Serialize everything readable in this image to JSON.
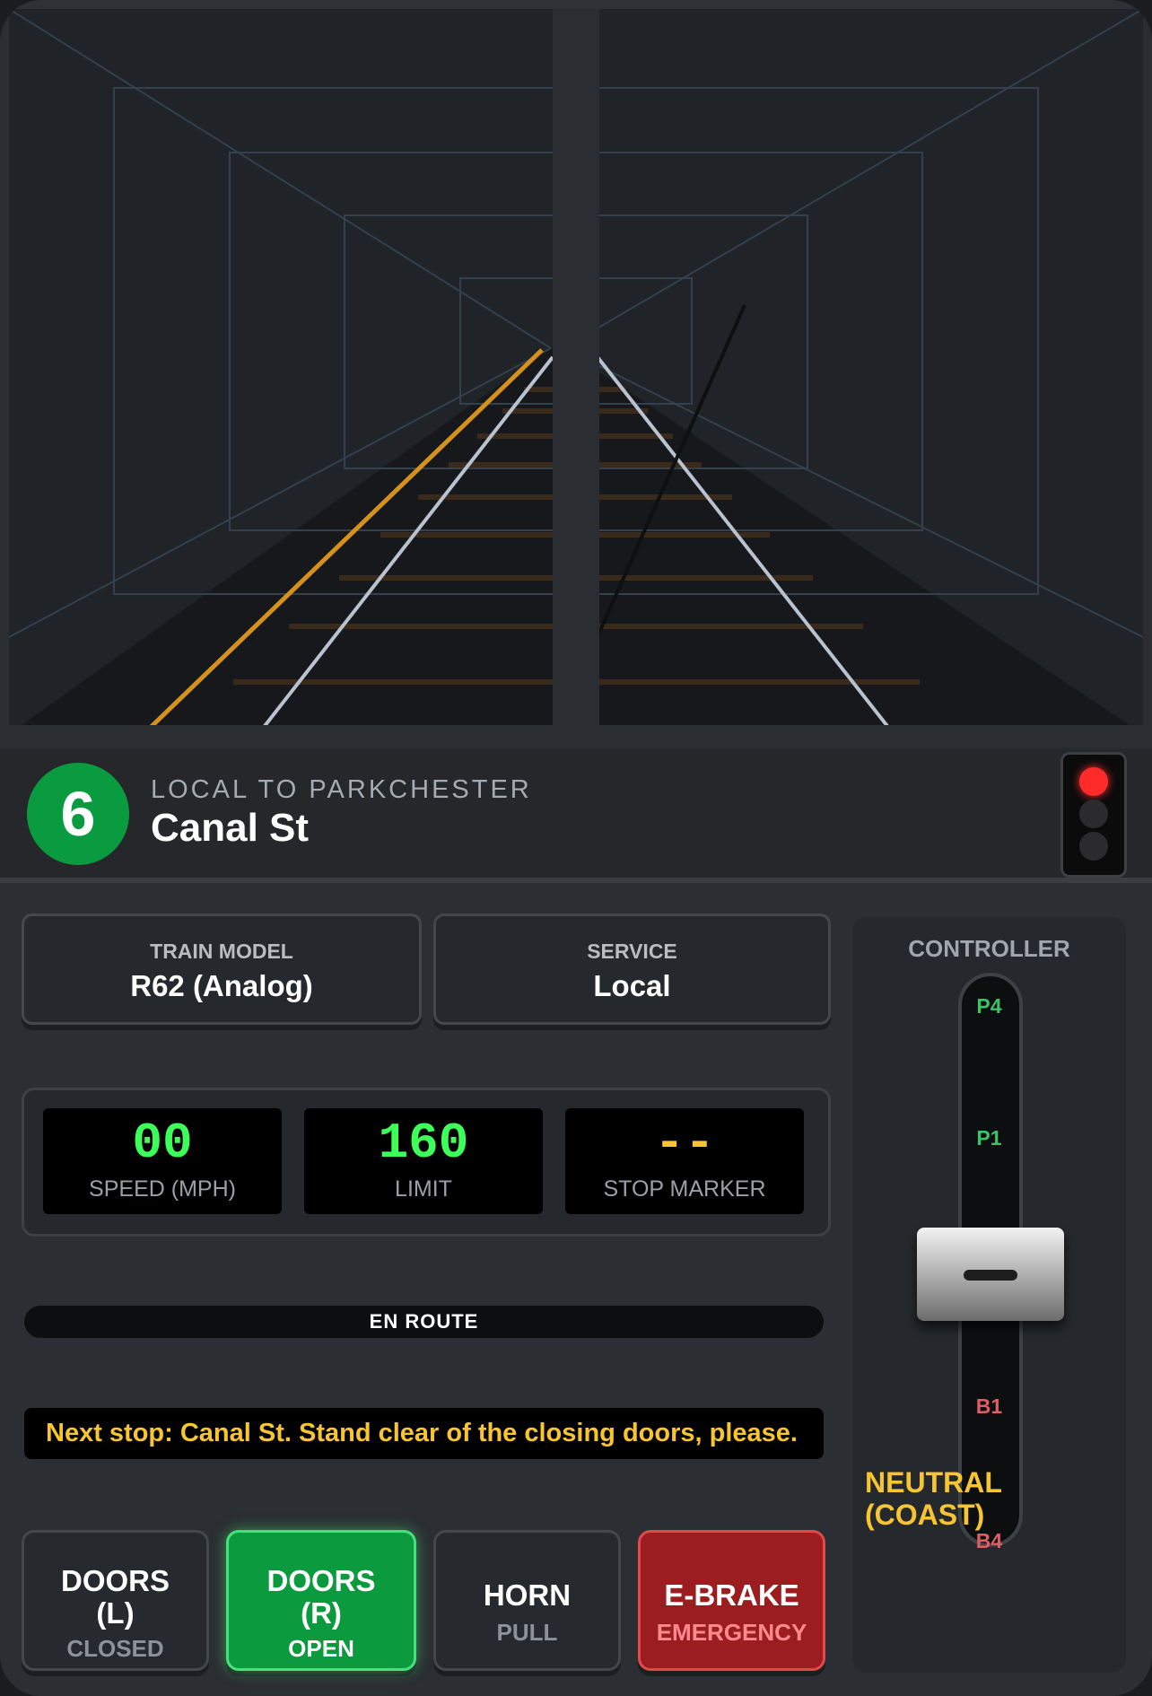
{
  "route": {
    "bullet": "6",
    "bullet_color": "#0a9a3f",
    "destination": "LOCAL TO PARKCHESTER",
    "station": "Canal St"
  },
  "signal": {
    "aspect": "red",
    "lamps": [
      "red",
      "off",
      "off"
    ]
  },
  "cards": {
    "train_model": {
      "label": "TRAIN MODEL",
      "value": "R62 (Analog)"
    },
    "service": {
      "label": "SERVICE",
      "value": "Local"
    }
  },
  "readouts": {
    "speed": {
      "value": "00",
      "label": "SPEED (MPH)"
    },
    "limit": {
      "value": "160",
      "label": "LIMIT"
    },
    "stop_marker": {
      "value": "--",
      "label": "STOP MARKER"
    }
  },
  "status": {
    "text": "EN ROUTE"
  },
  "ticker": {
    "text": "Next stop: Canal St. Stand clear of the closing doors, please."
  },
  "buttons": {
    "doors_left": {
      "label_line1": "DOORS",
      "label_line2": "(L)",
      "state": "CLOSED"
    },
    "doors_right": {
      "label_line1": "DOORS",
      "label_line2": "(R)",
      "state": "OPEN"
    },
    "horn": {
      "label": "HORN",
      "sub": "PULL"
    },
    "ebrake": {
      "label": "E-BRAKE",
      "sub": "EMERGENCY"
    }
  },
  "controller": {
    "title": "CONTROLLER",
    "notches": {
      "p4": "P4",
      "p1": "P1",
      "b1": "B1",
      "b4": "B4"
    },
    "state_line1": "NEUTRAL",
    "state_line2": "(COAST)"
  },
  "colors": {
    "accent_yellow": "#f7c531",
    "display_green": "#3dff59",
    "power": "#3ec267",
    "brake": "#e05d64"
  }
}
